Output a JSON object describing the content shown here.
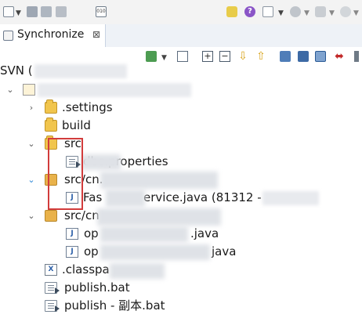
{
  "tab": {
    "title": "Synchronize",
    "close_glyph": "⊠"
  },
  "repo_label": "SVN (",
  "toolbar_glyphs": {
    "binary": "010",
    "question": "?"
  },
  "tree": [
    {
      "label": ".settings"
    },
    {
      "label": "build"
    },
    {
      "label": "src"
    },
    {
      "label": "dbc.properties"
    },
    {
      "label": "src/cn."
    },
    {
      "label": "Fas"
    },
    {
      "label": "ervice.java (81312 -"
    },
    {
      "label": "src/cn"
    },
    {
      "label": "op"
    },
    {
      "label": ".java"
    },
    {
      "label": "op"
    },
    {
      "label": "java"
    },
    {
      "label": ".classpa"
    },
    {
      "label": "publish.bat"
    },
    {
      "label": "publish - 副本.bat"
    }
  ],
  "icons": {
    "java": "J",
    "classpath": "X",
    "expanded": "⌄",
    "collapsed": "›"
  },
  "colors": {
    "highlight": "#d23c3c",
    "folder": "#f1c54d"
  }
}
